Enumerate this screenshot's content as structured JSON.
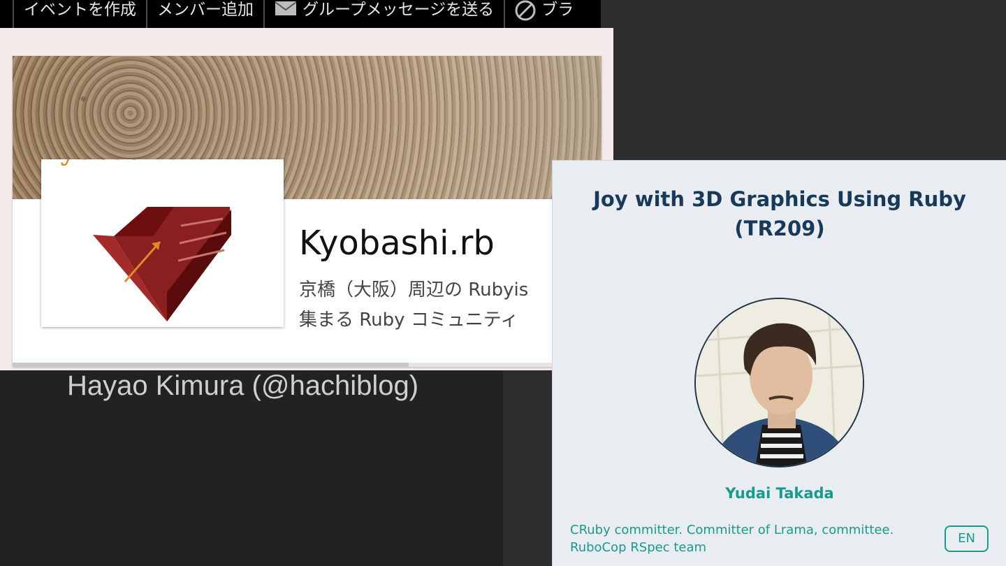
{
  "toolbar": {
    "items": [
      {
        "label": "イベントを作成",
        "icon": ""
      },
      {
        "label": "メンバー追加",
        "icon": ""
      },
      {
        "label": "グループメッセージを送る",
        "icon": "mail-icon"
      },
      {
        "label": "ブラ",
        "icon": "block-icon"
      }
    ]
  },
  "group": {
    "logo_text": "Kyobashi.rb",
    "name": "Kyobashi.rb",
    "description": "京橋（大阪）周辺の Rubyis\n集まる Ruby コミュニティ"
  },
  "speaker": {
    "text": "Hayao Kimura (@hachiblog)"
  },
  "talk": {
    "title_line1": "Joy with 3D Graphics Using Ruby",
    "title_line2": "(TR209)",
    "presenter": "Yudai Takada",
    "bio": "CRuby committer. Committer of Lrama, committee. RuboCop RSpec team",
    "language": "EN",
    "colors": {
      "accent": "#169b8c",
      "title": "#173a5a"
    }
  }
}
